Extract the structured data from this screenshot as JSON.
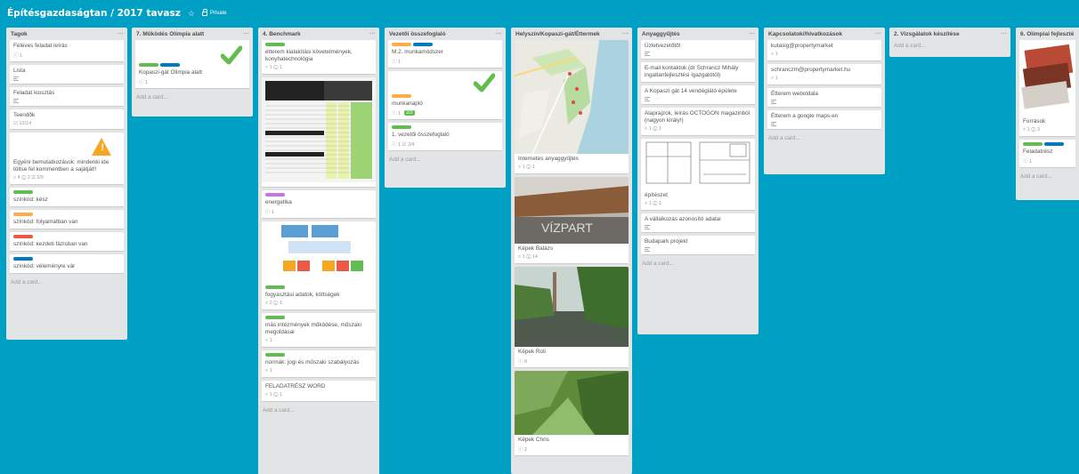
{
  "board": {
    "title": "Építésgazdaságtan / 2017 tavasz",
    "star": "☆",
    "visibility": "Private"
  },
  "add_card": "Add a card...",
  "lists": {
    "l1": {
      "name": "Tagok",
      "c1": {
        "title": "Féléves feladat leírás",
        "b": "ⓘ 1"
      },
      "c2": {
        "title": "Lista"
      },
      "c3": {
        "title": "Feladat kiosztás"
      },
      "c4": {
        "title": "Teendők",
        "b": "☑ 12/14"
      },
      "c5": {
        "title": "Egyéni bemutatkozások: mindenki ide töltse fel kommentben a sajátját!!",
        "b": "⌕ 4   ⓘ 2   ☑ 3/9"
      },
      "c6": {
        "title": "színkód: kész"
      },
      "c7": {
        "title": "színkód: folyamatban van"
      },
      "c8": {
        "title": "színkód: kezdeti fázisban van"
      },
      "c9": {
        "title": "színkód: véleményre vár"
      }
    },
    "l2": {
      "name": "7. Működés Olimpia alatt",
      "c1": {
        "title": "Kopaszi-gát Olimpia alatt",
        "b": "ⓘ 1"
      }
    },
    "l3": {
      "name": "4. Benchmark",
      "c1": {
        "title": "étterem kialakítási követelmények, konyhatechnológia",
        "b": "⌕ 1   ⓘ 1"
      },
      "c2": {
        "title": "energetika",
        "b": "ⓘ 1"
      },
      "c3": {
        "title": "fogyasztási adatok, költségek",
        "b": "⌕ 2   ⓘ 1"
      },
      "c4": {
        "title": "más intézmények működése, műszaki megoldásai",
        "b": "⌕ 1"
      },
      "c5": {
        "title": "normák: jogi és műszaki szabályozás",
        "b": "⌕ 1"
      },
      "c6": {
        "title": "FELADATRÉSZ WORD",
        "b": "⌕ 1   ⓘ 1"
      }
    },
    "l4": {
      "name": "Vezetői összefoglaló",
      "c1": {
        "title": "M.2. munkamódszer",
        "b": "ⓘ 1"
      },
      "c2": {
        "title": "munkanapló",
        "b": "ⓘ 1",
        "badge": "2/2"
      },
      "c3": {
        "title": "1. vezetői összefoglaló",
        "b": "ⓘ 1   ☑ 2/4"
      }
    },
    "l5": {
      "name": "Helyszín/Kopaszi-gát/Éttermek",
      "c1": {
        "title": "Internetes anyaggyűjtés",
        "b": "⌕ 1   ⓘ 1"
      },
      "c2": {
        "title": "Képek Balázs",
        "b": "⌕ 1   ⓘ 14"
      },
      "c3": {
        "title": "Képek Roli",
        "b": "ⓘ 8"
      },
      "c4": {
        "title": "Képek Chris",
        "b": "ⓘ 2"
      },
      "img_text": "VÍZPART"
    },
    "l6": {
      "name": "Anyaggyűjtés",
      "c1": {
        "title": "Üzletvezetőtől"
      },
      "c2": {
        "title": "E-mail kontaktok (dr Schrancz Mihály ingatlanfejlesztési igazgatótól)"
      },
      "c3": {
        "title": "A Kopaszi gát 14 vendéglátó épülete"
      },
      "c4": {
        "title": "Alaprajzok, leírás OCTOGON magazinból (nagyon király!)",
        "b": "⌕ 1   ⓘ 1"
      },
      "c5": {
        "title": "építészet",
        "b": "⌕ 1   ⓘ 1"
      },
      "c6": {
        "title": "A vállalkozás azonosító adatai"
      },
      "c7": {
        "title": "Budapark projekt"
      }
    },
    "l7": {
      "name": "Kapcsolatok//hivatkozások",
      "c1": {
        "title": "kutasig@propertymarket",
        "b": "⌕ 1"
      },
      "c2": {
        "title": "schranczm@propertymarket.hu",
        "b": "⌕ 1"
      },
      "c3": {
        "title": "Étterem weboldala"
      },
      "c4": {
        "title": "Étterem a google maps-en"
      }
    },
    "l8": {
      "name": "2. Vizsgálatok készítése"
    },
    "l9": {
      "name": "6. Olimpiai fejleszté",
      "c1": {
        "title": "Források",
        "b": "⌕ 1   ⓘ 3"
      },
      "c2": {
        "title": "Feladatrész",
        "b": "ⓘ 1"
      }
    }
  },
  "colors": {
    "background": "#00a0c4",
    "green": "#61bd4f",
    "orange": "#ffab4a",
    "red": "#eb5a46",
    "blue": "#0079bf",
    "purple": "#c377e0"
  }
}
